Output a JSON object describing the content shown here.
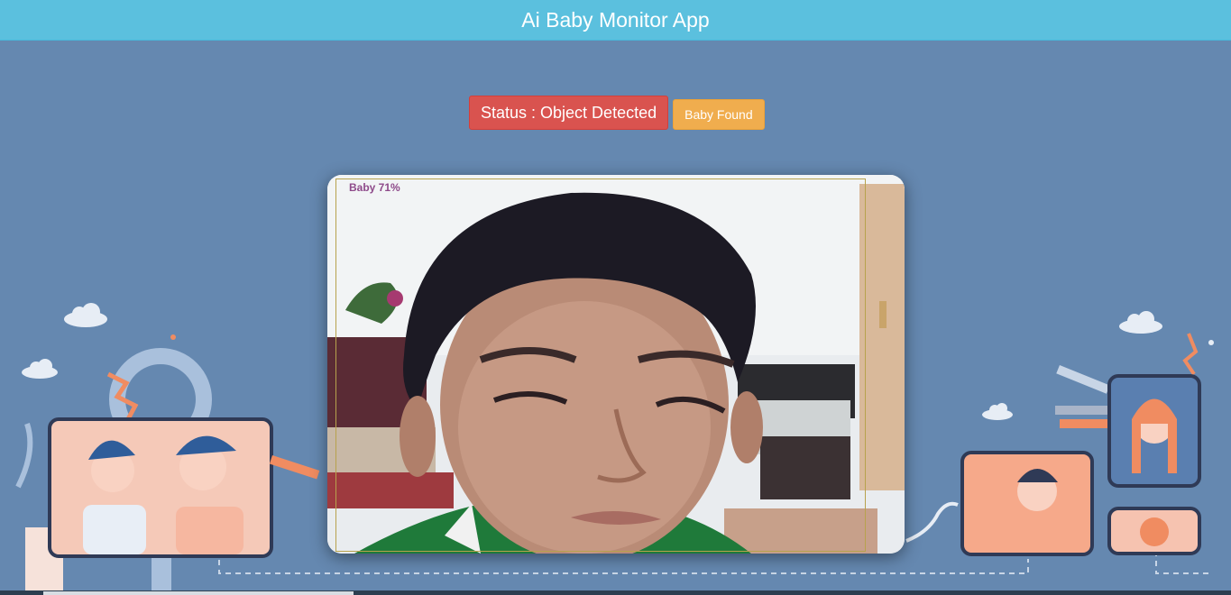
{
  "header": {
    "title": "Ai Baby Monitor App"
  },
  "status": {
    "label": "Status : Object Detected",
    "badge": "Baby Found",
    "status_color": "#d9534f",
    "badge_color": "#f0ad4e"
  },
  "video": {
    "detection_label": "Baby 71%"
  },
  "colors": {
    "header": "#5bc0de",
    "background": "#6588b0"
  }
}
